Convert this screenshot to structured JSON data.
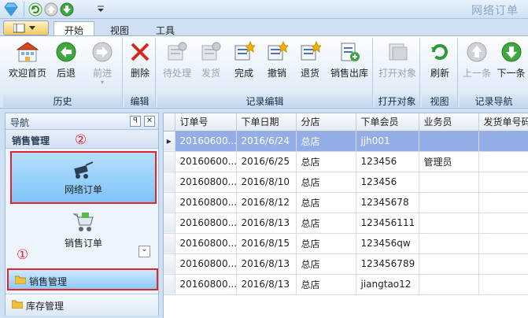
{
  "window": {
    "title": "网络订单"
  },
  "tabs": [
    {
      "label": "开始",
      "active": true
    },
    {
      "label": "视图",
      "active": false
    },
    {
      "label": "工具",
      "active": false
    }
  ],
  "ribbon": {
    "groups": [
      {
        "label": "历史",
        "buttons": [
          {
            "label": "欢迎首页",
            "icon": "home-icon",
            "enabled": true
          },
          {
            "label": "后退",
            "icon": "arrow-left-icon",
            "enabled": true
          },
          {
            "label": "前进",
            "icon": "arrow-right-icon",
            "enabled": false
          }
        ]
      },
      {
        "label": "编辑",
        "buttons": [
          {
            "label": "删除",
            "icon": "delete-x-icon",
            "enabled": true
          }
        ]
      },
      {
        "label": "记录编辑",
        "buttons": [
          {
            "label": "待处理",
            "icon": "document-gear-icon",
            "enabled": false
          },
          {
            "label": "发货",
            "icon": "document-gear-icon",
            "enabled": false
          },
          {
            "label": "完成",
            "icon": "document-star-icon",
            "enabled": true
          },
          {
            "label": "撤销",
            "icon": "document-star-icon",
            "enabled": true
          },
          {
            "label": "退货",
            "icon": "document-star-icon",
            "enabled": true
          },
          {
            "label": "销售出库",
            "icon": "document-add-icon",
            "enabled": true
          }
        ]
      },
      {
        "label": "打开对象",
        "buttons": [
          {
            "label": "打开对象",
            "icon": "open-object-icon",
            "enabled": false
          }
        ]
      },
      {
        "label": "视图",
        "buttons": [
          {
            "label": "刷新",
            "icon": "refresh-icon",
            "enabled": true
          }
        ]
      },
      {
        "label": "记录导航",
        "buttons": [
          {
            "label": "上一条",
            "icon": "arrow-up-icon",
            "enabled": false
          },
          {
            "label": "下一条",
            "icon": "arrow-down-icon",
            "enabled": true
          }
        ]
      }
    ]
  },
  "nav": {
    "header": "导航",
    "pin_glyph": "ꟼ",
    "close_glyph": "✕",
    "section_title": "销售管理",
    "items": [
      {
        "label": "网络订单",
        "icon": "cart-icon",
        "selected": true
      },
      {
        "label": "销售订单",
        "icon": "shopping-cart-icon",
        "selected": false
      }
    ],
    "expand_glyph": "⌄",
    "bars": [
      {
        "label": "销售管理",
        "active": true
      },
      {
        "label": "库存管理",
        "active": false
      }
    ],
    "annotations": {
      "one": "①",
      "two": "②"
    }
  },
  "grid": {
    "indicator": "▸",
    "columns": [
      "订单号",
      "下单日期",
      "分店",
      "下单会员",
      "业务员",
      "发货单号码"
    ],
    "rows": [
      [
        "20160600...",
        "2016/6/24",
        "总店",
        "jjh001",
        ""
      ],
      [
        "20160600...",
        "2016/6/25",
        "总店",
        "123456",
        "管理员"
      ],
      [
        "20160800...",
        "2016/8/10",
        "总店",
        "123456",
        ""
      ],
      [
        "20160800...",
        "2016/8/12",
        "总店",
        "12345678",
        ""
      ],
      [
        "20160800...",
        "2016/8/13",
        "总店",
        "123456111",
        ""
      ],
      [
        "20160800...",
        "2016/8/15",
        "总店",
        "123456qw",
        ""
      ],
      [
        "20160800...",
        "2016/8/13",
        "总店",
        "123456789",
        ""
      ],
      [
        "20160800...",
        "2016/8/13",
        "总店",
        "jiangtao12",
        ""
      ]
    ],
    "selected_row": 0
  },
  "colors": {
    "accent": "#e2252b",
    "selection": "#93aee6",
    "ribbon": "#dbe7f6"
  }
}
